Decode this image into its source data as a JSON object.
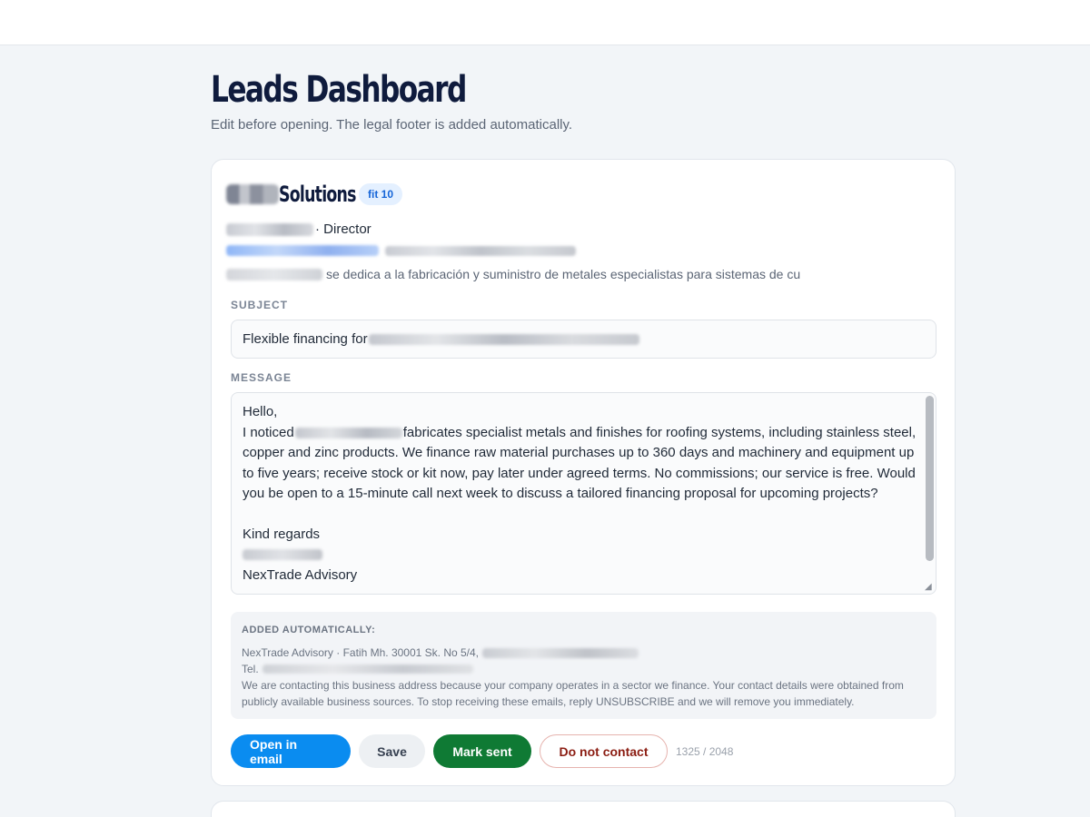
{
  "page": {
    "title": "Leads Dashboard",
    "subtitle": "Edit before opening. The legal footer is added automatically."
  },
  "lead": {
    "company_suffix": "Solutions",
    "fit_badge": "fit 10",
    "role": "· Director",
    "description": "se dedica a la fabricación y suministro de metales especialistas para sistemas de cu"
  },
  "form": {
    "subject_label": "SUBJECT",
    "subject_value": "Flexible financing for",
    "message_label": "MESSAGE",
    "message": {
      "greeting": "Hello,",
      "line1_prefix": "I noticed",
      "body": "fabricates specialist metals and finishes for roofing systems, including stainless steel, copper and zinc products. We finance raw material purchases up to 360 days and machinery and equipment up to five years; receive stock or kit now, pay later under agreed terms. No commissions; our service is free. Would you be open to a 15-minute call next week to discuss a tailored financing proposal for upcoming projects?",
      "closing": "Kind regards",
      "company": "NexTrade Advisory"
    }
  },
  "footer": {
    "label": "ADDED AUTOMATICALLY:",
    "address": "NexTrade Advisory · Fatih Mh. 30001 Sk. No 5/4,",
    "tel": "Tel.",
    "note": "We are contacting this business address because your company operates in a sector we finance. Your contact details were obtained from publicly available business sources. To stop receiving these emails, reply UNSUBSCRIBE and we will remove you immediately."
  },
  "actions": {
    "open_email": "Open in email",
    "save": "Save",
    "mark_sent": "Mark sent",
    "do_not_contact": "Do not contact",
    "char_count": "1325 / 2048"
  },
  "colors": {
    "primary": "#0a8cf0",
    "success": "#0f7a34",
    "danger": "#8b1d12",
    "badge_bg": "#e4f0ff",
    "badge_text": "#1565d8"
  }
}
